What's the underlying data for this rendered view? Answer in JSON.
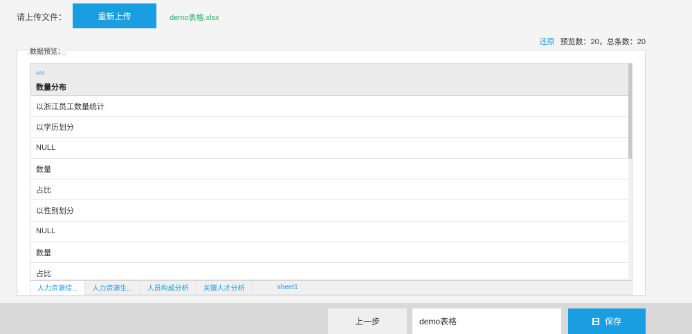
{
  "upload": {
    "label": "请上传文件：",
    "reupload_label": "重新上传",
    "file_name": "demo表格.xlsx"
  },
  "stats": {
    "restore_label": "还原",
    "summary": "预览数：20，总条数：20"
  },
  "preview": {
    "legend": "数据预览：",
    "column": {
      "type_tag": "ABC",
      "name": "数量分布"
    },
    "rows": [
      "以浙江员工数量统计",
      "以学历划分",
      "NULL",
      "数量",
      "占比",
      "以性别划分",
      "NULL",
      "数量",
      "占比"
    ],
    "sheets": [
      "人力资源综...",
      "人力资源生...",
      "人员构成分析",
      "关键人才分析",
      "sheet1"
    ]
  },
  "footer": {
    "prev_label": "上一步",
    "name_value": "demo表格",
    "save_label": "保存"
  },
  "colors": {
    "accent": "#1a9de1",
    "file_green": "#27ae60"
  },
  "icons": {
    "save": "floppy-disk-icon"
  }
}
